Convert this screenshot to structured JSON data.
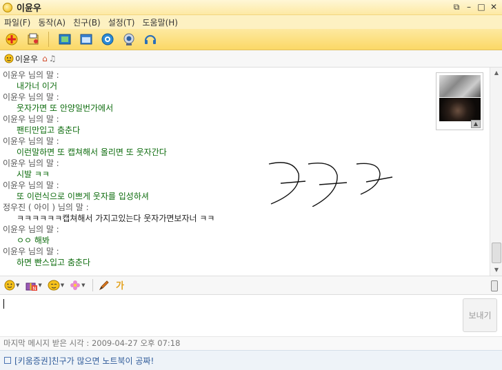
{
  "window": {
    "title": "이윤우",
    "controls": [
      "restore-down",
      "minimize",
      "maximize",
      "close"
    ]
  },
  "menu": [
    "파일(F)",
    "동작(A)",
    "친구(B)",
    "설정(T)",
    "도움말(H)"
  ],
  "toolbar": {
    "icons": [
      "add-friend-icon",
      "file-send-icon",
      "picture-icon",
      "window-icon",
      "globe-icon",
      "webcam-icon",
      "headset-icon"
    ]
  },
  "contact": {
    "name": "이윤우",
    "icons": [
      "home-icon",
      "music-icon"
    ]
  },
  "messages": [
    {
      "sender": "이윤우 님의 말 :",
      "text": "내가너 이거",
      "mine": true
    },
    {
      "sender": "이윤우 님의 말 :",
      "text": "웃자가면 또 안양일번가에서",
      "mine": true
    },
    {
      "sender": "이윤우 님의 말 :",
      "text": "팬티만입고 춤춘다",
      "mine": true
    },
    {
      "sender": "이윤우 님의 말 :",
      "text": "이런말하면 또 캡쳐해서 올리면 또 웃자간다",
      "mine": true
    },
    {
      "sender": "이윤우 님의 말 :",
      "text": "시발 ㅋㅋ",
      "mine": true
    },
    {
      "sender": "이윤우 님의 말 :",
      "text": "또 이런식으로 이쁘게 웃자를 입성하셔",
      "mine": true
    },
    {
      "sender": "정우진 ( 아이 ) 님의 말 :",
      "text": "ㅋㅋㅋㅋㅋㅋ캡쳐해서 가지고있는다 웃자가면보자너 ㅋㅋ",
      "mine": false
    },
    {
      "sender": "이윤우 님의 말 :",
      "text": "ㅇㅇ 해봐",
      "mine": true
    },
    {
      "sender": "이윤우 님의 말 :",
      "text": "하면 빤스입고 춤춘다",
      "mine": true
    }
  ],
  "input": {
    "value": "",
    "send_label": "보내기"
  },
  "status": {
    "last_received": "마지막 메시지 받은 시각 : 2009-04-27 오후 07:18"
  },
  "ad": {
    "text": "[키움증권]친구가 많으면 노트북이 공짜!"
  },
  "colors": {
    "title_bg": "#fde9a3",
    "toolbar_bg": "#fbd866",
    "my_message": "#0c6b0c",
    "ad_text": "#2e5a99"
  }
}
